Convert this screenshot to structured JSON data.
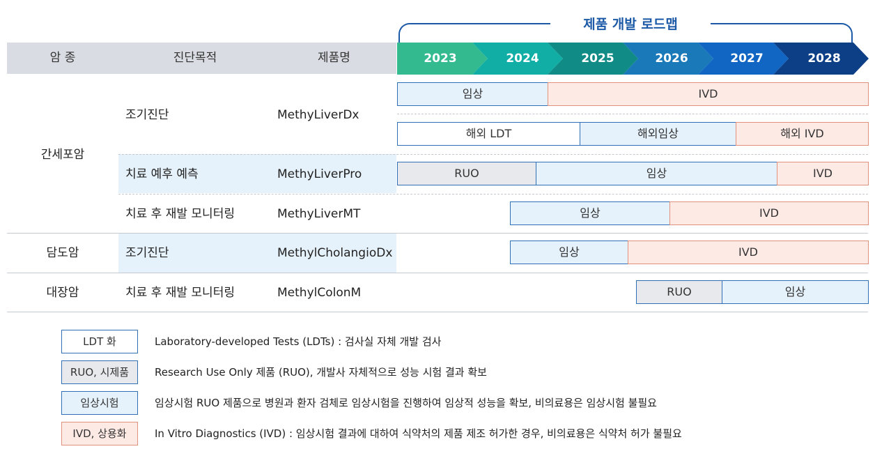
{
  "roadmap_title": "제품 개발 로드맵",
  "header": {
    "cancer_type": "암 종",
    "purpose": "진단목적",
    "product": "제품명",
    "years": [
      "2023",
      "2024",
      "2025",
      "2026",
      "2027",
      "2028"
    ],
    "year_colors": [
      "#33bb8f",
      "#11aea6",
      "#118b85",
      "#1a79b8",
      "#1266c3",
      "#0d3f86"
    ]
  },
  "rows": [
    {
      "cancer": "간세포암",
      "purpose": "조기진단",
      "product": "MethyLiverDx",
      "stages": [
        {
          "label": "임상",
          "kind": "clinical"
        },
        {
          "label": "IVD",
          "kind": "ivd"
        }
      ],
      "stages_overseas": [
        {
          "label": "해외 LDT",
          "kind": "ldt"
        },
        {
          "label": "해외임상",
          "kind": "clinical"
        },
        {
          "label": "해외 IVD",
          "kind": "ivd"
        }
      ]
    },
    {
      "purpose": "치료 예후 예측",
      "product": "MethyLiverPro",
      "stages": [
        {
          "label": "RUO",
          "kind": "ruo"
        },
        {
          "label": "임상",
          "kind": "clinical"
        },
        {
          "label": "IVD",
          "kind": "ivd"
        }
      ]
    },
    {
      "purpose": "치료 후 재발 모니터링",
      "product": "MethyLiverMT",
      "stages": [
        {
          "label": "임상",
          "kind": "clinical"
        },
        {
          "label": "IVD",
          "kind": "ivd"
        }
      ]
    },
    {
      "cancer": "담도암",
      "purpose": "조기진단",
      "product": "MethylCholangioDx",
      "stages": [
        {
          "label": "임상",
          "kind": "clinical"
        },
        {
          "label": "IVD",
          "kind": "ivd"
        }
      ]
    },
    {
      "cancer": "대장암",
      "purpose": "치료 후 재발 모니터링",
      "product": "MethylColonM",
      "stages": [
        {
          "label": "RUO",
          "kind": "ruo"
        },
        {
          "label": "임상",
          "kind": "clinical"
        }
      ]
    }
  ],
  "legend": [
    {
      "box": "LDT 화",
      "kind": "ldt",
      "text": "Laboratory-developed Tests (LDTs) : 검사실 자체 개발 검사"
    },
    {
      "box": "RUO, 시제품",
      "kind": "ruo",
      "text": "Research Use Only 제품 (RUO), 개발사 자체적으로 성능 시험 결과 확보"
    },
    {
      "box": "임상시험",
      "kind": "clinical",
      "text": "임상시험 RUO 제품으로 병원과 환자 검체로 임상시험을 진행하여 임상적 성능을 확보, 비의료용은 임상시험 불필요"
    },
    {
      "box": "IVD, 상용화",
      "kind": "ivd",
      "text": "In Vitro Diagnostics (IVD) : 임상시험 결과에 대하여 식약처의 제품 제조 허가한 경우, 비의료용은 식약처 허가 불필요"
    }
  ],
  "colors": {
    "accent": "#1c5aa8",
    "ldt_border": "#2f6fb5",
    "clinical_fill": "#e6f2fb",
    "ruo_fill": "#e8e9ed",
    "ivd_fill": "#fdeae5",
    "ivd_border": "#e0907c"
  }
}
